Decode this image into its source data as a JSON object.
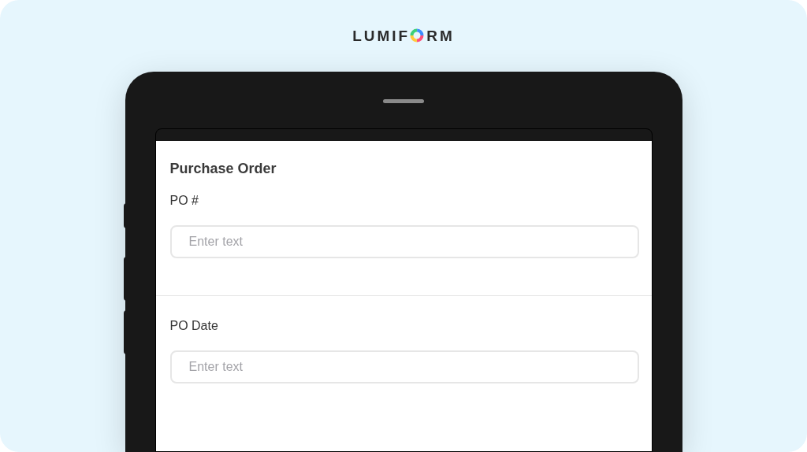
{
  "logo": {
    "start": "LUMIF",
    "end": "RM"
  },
  "form": {
    "title": "Purchase Order",
    "fields": [
      {
        "label": "PO #",
        "placeholder": "Enter text"
      },
      {
        "label": "PO Date",
        "placeholder": "Enter text"
      }
    ]
  }
}
